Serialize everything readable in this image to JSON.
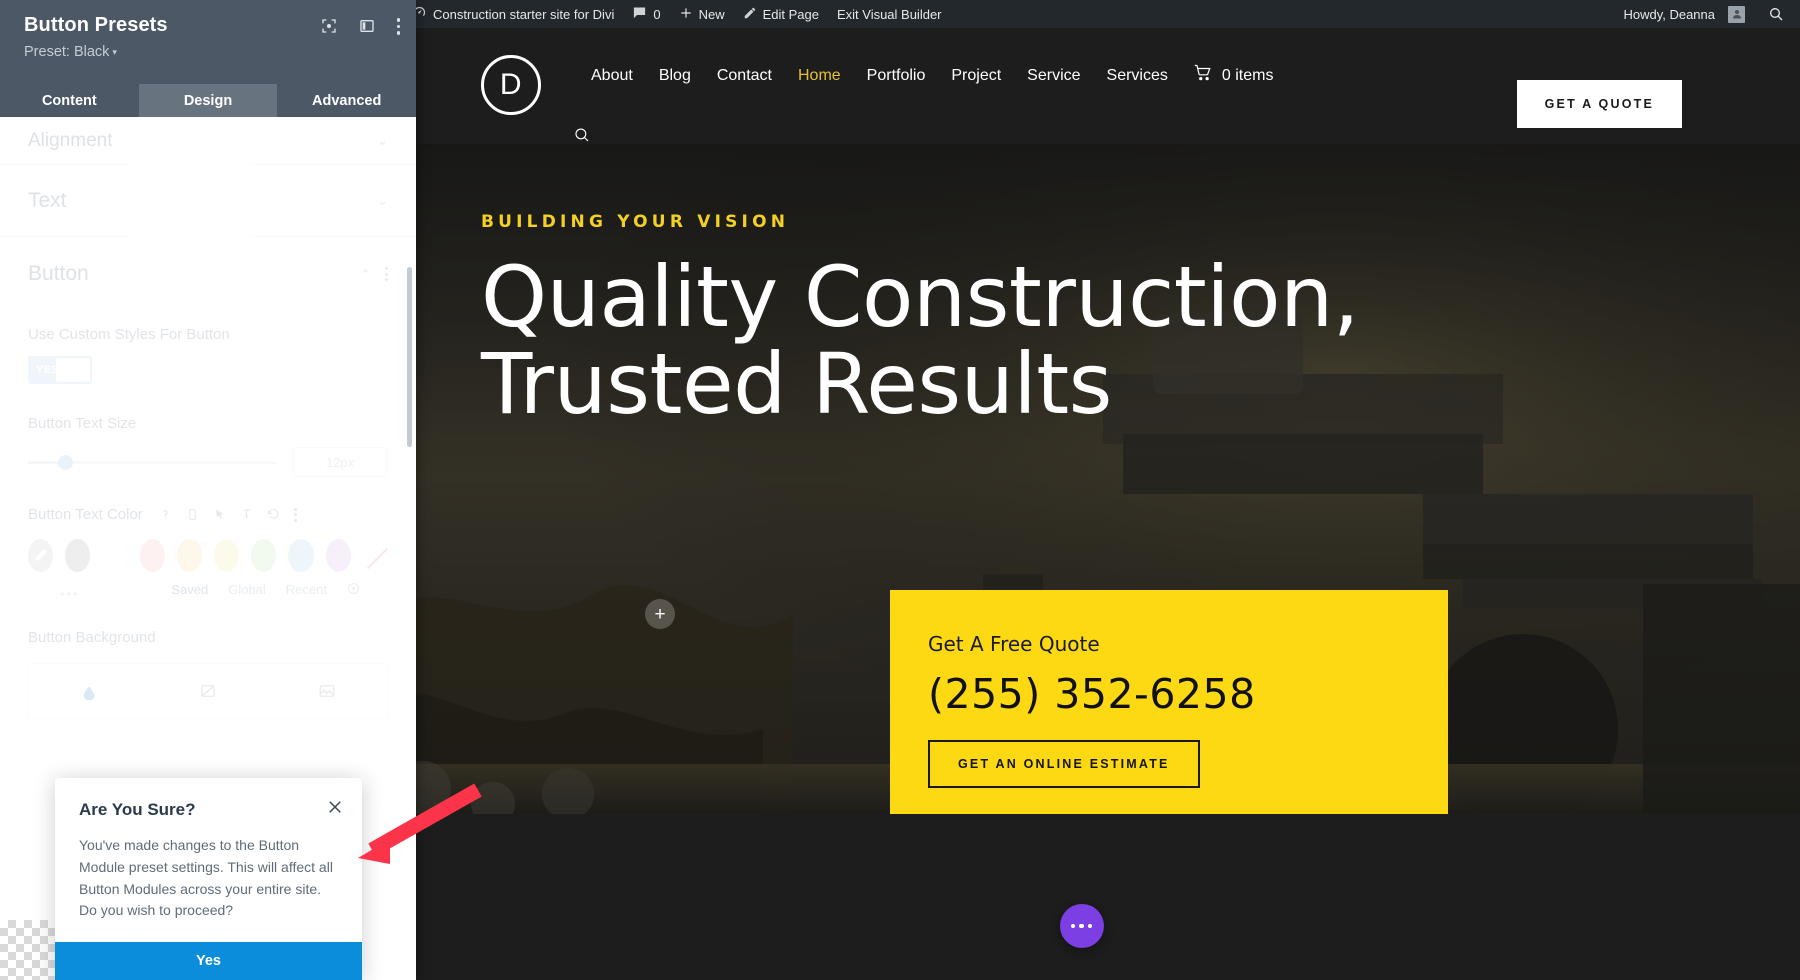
{
  "panel": {
    "title": "Button Presets",
    "preset_label": "Preset: Black",
    "caret": "▾",
    "icons": {
      "focus": "focus-target-icon",
      "layout": "panel-layout-icon",
      "more": "more-options-icon"
    },
    "tabs": [
      {
        "label": "Content",
        "active": false
      },
      {
        "label": "Design",
        "active": true
      },
      {
        "label": "Advanced",
        "active": false
      }
    ],
    "sections": [
      {
        "label": "Alignment",
        "expanded": false
      },
      {
        "label": "Text",
        "expanded": false
      },
      {
        "label": "Button",
        "expanded": true
      }
    ],
    "fields": {
      "custom_styles_label": "Use Custom Styles For Button",
      "custom_styles_value": "YES",
      "text_size_label": "Button Text Size",
      "text_size_value": "12px",
      "text_color_label": "Button Text Color",
      "background_label": "Button Background"
    },
    "color_tabs": [
      "Saved",
      "Global",
      "Recent"
    ],
    "color_tabs_active": "Saved",
    "swatches": [
      "#cfcfcf",
      "#b3b3b3",
      "#ffffff",
      "#f7c3c3",
      "#f8dcae",
      "#f6f0a9",
      "#c8e6b4",
      "#b9d8ef",
      "#dfc0f0",
      "#f08a9c"
    ],
    "dots": "•••"
  },
  "modal": {
    "title": "Are You Sure?",
    "body": "You've made changes to the Button Module preset settings. This will affect all Button Modules across your entire site. Do you wish to proceed?",
    "confirm_label": "Yes",
    "close_icon": "close-icon",
    "confirm_color": "#0c8ddb"
  },
  "adminbar": {
    "wp_logo": "wordpress-logo-icon",
    "site_icon": "dashboard-icon",
    "site_name": "Construction starter site for Divi",
    "comments_icon": "comment-bubble-icon",
    "comments_count": "0",
    "new_icon": "plus-icon",
    "new_label": "New",
    "edit_icon": "pencil-icon",
    "edit_label": "Edit Page",
    "exit_label": "Exit Visual Builder",
    "howdy": "Howdy, Deanna",
    "avatar": "user-avatar",
    "search_icon": "search-icon"
  },
  "site": {
    "logo_letter": "D",
    "nav": [
      {
        "label": "About",
        "active": false
      },
      {
        "label": "Blog",
        "active": false
      },
      {
        "label": "Contact",
        "active": false
      },
      {
        "label": "Home",
        "active": true
      },
      {
        "label": "Portfolio",
        "active": false
      },
      {
        "label": "Project",
        "active": false
      },
      {
        "label": "Service",
        "active": false
      },
      {
        "label": "Services",
        "active": false
      }
    ],
    "cart_icon": "shopping-cart-icon",
    "cart_label": "0 items",
    "search_icon": "search-icon",
    "quote_button": "GET A QUOTE",
    "accent_yellow": "#f2d024",
    "hero": {
      "eyebrow": "BUILDING YOUR VISION",
      "title_line1": "Quality Construction,",
      "title_line2": "Trusted Results"
    },
    "quote_card": {
      "label": "Get A Free Quote",
      "phone": "(255) 352-6258",
      "button": "GET AN ONLINE ESTIMATE",
      "background": "#fcd913"
    },
    "add_module_icon": "plus-icon",
    "fab_icon": "ellipsis-icon",
    "fab_color": "#7b3fe4"
  }
}
